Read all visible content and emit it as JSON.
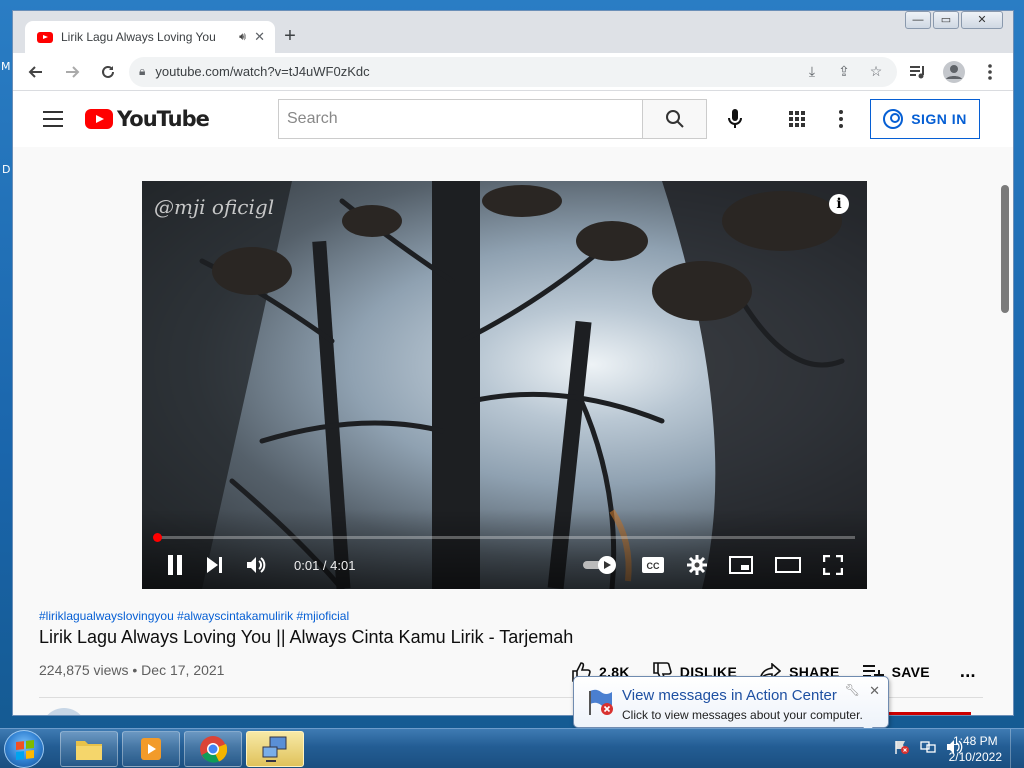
{
  "desktop": {
    "frag1": "M",
    "frag2": "D"
  },
  "browser": {
    "tab_title": "Lirik Lagu Always Loving You",
    "new_tab": "+",
    "window_controls": {
      "minimize": "—",
      "restore": "▭",
      "close": "✕"
    },
    "url": "youtube.com/watch?v=tJ4uWF0zKdc"
  },
  "youtube": {
    "logo_text": "YouTube",
    "search_placeholder": "Search",
    "sign_in": "SIGN IN"
  },
  "video": {
    "watermark": "@mji oficigl",
    "info": "i",
    "time": "0:01 / 4:01",
    "progress_fraction": 0.004
  },
  "meta": {
    "hashtags": "#liriklagualwayslovingyou #alwayscintakamulirik #mjioficial",
    "title": "Lirik Lagu Always Loving You || Always Cinta Kamu Lirik - Tarjemah",
    "stats": "224,875 views • Dec 17, 2021",
    "likes": "2.8K",
    "dislike": "DISLIKE",
    "share": "SHARE",
    "save": "SAVE",
    "more": "..."
  },
  "notification": {
    "title": "View messages in Action Center",
    "subtitle": "Click to view messages about your computer.",
    "close": "✕"
  },
  "taskbar": {
    "time": "1:48 PM",
    "date": "2/10/2022"
  },
  "colors": {
    "yt_red": "#ff0000",
    "link_blue": "#065fd4",
    "taskbar": "#235d94"
  }
}
